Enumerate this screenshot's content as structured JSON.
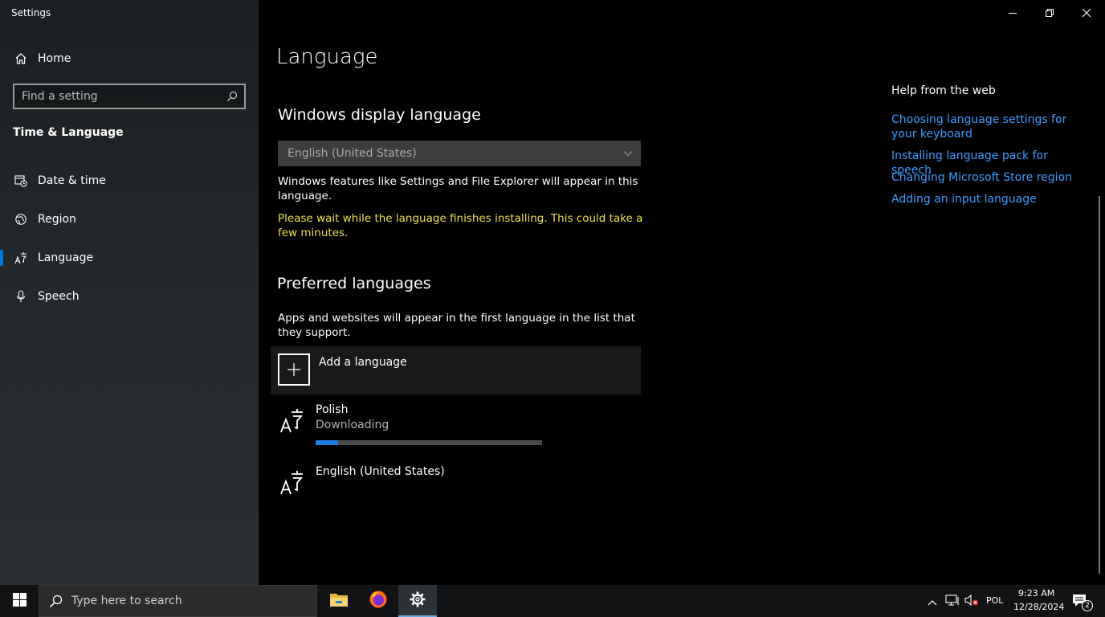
{
  "window": {
    "title": "Settings"
  },
  "sidebar": {
    "home_label": "Home",
    "search_placeholder": "Find a setting",
    "section_title": "Time & Language",
    "items": [
      {
        "label": "Date & time",
        "icon": "calendar-clock-icon"
      },
      {
        "label": "Region",
        "icon": "globe-icon"
      },
      {
        "label": "Language",
        "icon": "language-icon",
        "active": true
      },
      {
        "label": "Speech",
        "icon": "microphone-icon"
      }
    ]
  },
  "main": {
    "title": "Language",
    "display_language": {
      "heading": "Windows display language",
      "selected": "English (United States)",
      "description": "Windows features like Settings and File Explorer will appear in this language.",
      "warning": "Please wait while the language finishes installing. This could take a few minutes."
    },
    "preferred": {
      "heading": "Preferred languages",
      "description": "Apps and websites will appear in the first language in the list that they support.",
      "add_label": "Add a language",
      "languages": [
        {
          "name": "Polish",
          "status": "Downloading",
          "progress": 0.1
        },
        {
          "name": "English (United States)"
        }
      ]
    }
  },
  "help": {
    "title": "Help from the web",
    "links": [
      "Choosing language settings for your keyboard",
      "Installing language pack for speech",
      "Changing Microsoft Store region",
      "Adding an input language"
    ]
  },
  "taskbar": {
    "search_placeholder": "Type here to search",
    "apps": [
      "file-explorer-icon",
      "firefox-icon",
      "settings-gear-icon"
    ],
    "input_language": "POL",
    "time": "9:23 AM",
    "date": "12/28/2024",
    "notification_count": "2"
  },
  "colors": {
    "accent": "#0078d7",
    "link": "#3a9cff",
    "warning": "#e8e04a"
  }
}
